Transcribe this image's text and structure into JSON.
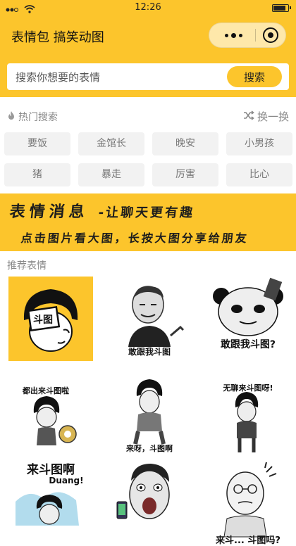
{
  "status_bar": {
    "time": "12:26"
  },
  "title_bar": {
    "title": "表情包 搞笑动图"
  },
  "search": {
    "placeholder": "搜索你想要的表情",
    "button_label": "搜索"
  },
  "hot_search": {
    "label": "热门搜索",
    "refresh_label": "换一换",
    "tags": [
      "要饭",
      "金馆长",
      "晚安",
      "小男孩",
      "猪",
      "暴走",
      "厉害",
      "比心"
    ]
  },
  "banner": {
    "line1_main": "表情消息",
    "line1_sub": "-让聊天更有趣",
    "line2": "点击图片看大图，长按大图分享给朋友"
  },
  "recommend": {
    "heading": "推荐表情",
    "items": [
      {
        "caption": "斗图",
        "icon": "bowl-cut-kid-doutu-sign"
      },
      {
        "caption": "敢跟我斗图",
        "icon": "man-pointing-meme"
      },
      {
        "caption": "敢跟我斗图?",
        "icon": "panda-head-meme"
      },
      {
        "caption": "都出来斗图啦",
        "icon": "kid-with-gong-meme"
      },
      {
        "caption": "来呀，斗图啊",
        "icon": "kid-sitting-meme"
      },
      {
        "caption": "无聊来斗图呀!",
        "icon": "kid-standing-meme"
      },
      {
        "caption": "来斗图啊",
        "icon": "kid-splash-meme",
        "extra": "Duang!"
      },
      {
        "caption": "",
        "icon": "screaming-man-phone-meme"
      },
      {
        "caption": "来斗... 斗图吗?",
        "icon": "old-man-meme"
      }
    ]
  },
  "colors": {
    "accent": "#fcc52c",
    "tag_bg": "#f2f2f2",
    "muted_text": "#888888"
  }
}
